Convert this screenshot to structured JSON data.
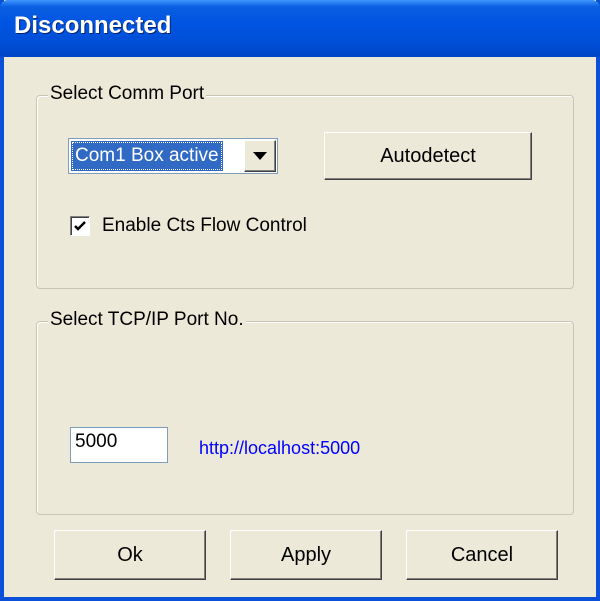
{
  "window": {
    "title": "Disconnected"
  },
  "comm_port": {
    "group_label": "Select Comm Port",
    "selected_port": "Com1 Box active",
    "autodetect_label": "Autodetect",
    "flow_control_label": "Enable Cts Flow Control",
    "flow_control_checked": true
  },
  "tcp_port": {
    "group_label": "Select TCP/IP Port No.",
    "port_value": "5000",
    "url": "http://localhost:5000"
  },
  "buttons": {
    "ok_label": "Ok",
    "apply_label": "Apply",
    "cancel_label": "Cancel"
  },
  "colors": {
    "titlebar": "#0054e3",
    "face": "#ece9d8",
    "selection": "#316ac5",
    "link": "#0000ff"
  }
}
